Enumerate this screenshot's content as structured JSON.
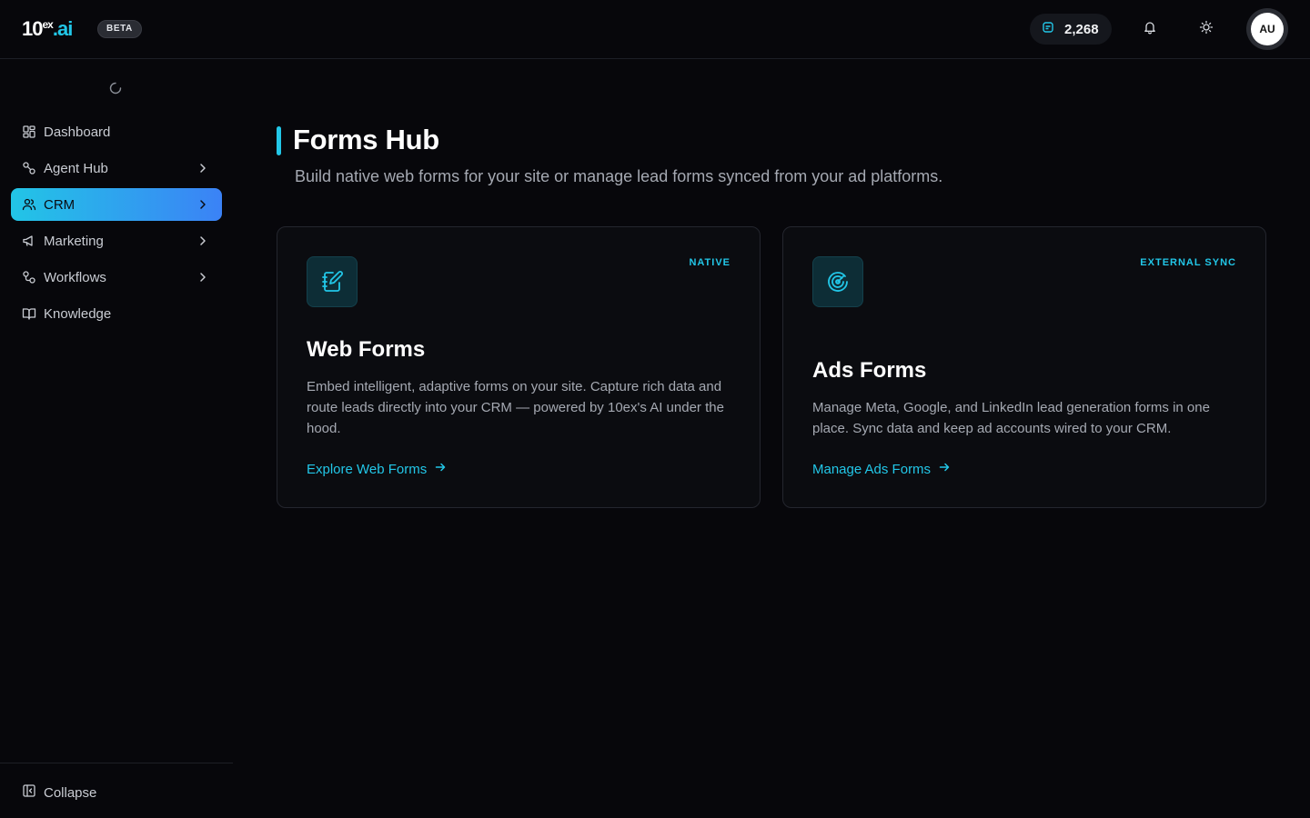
{
  "brand": {
    "ten": "10",
    "ex": "ex",
    "ai": ".ai",
    "badge": "BETA"
  },
  "topbar": {
    "credits": "2,268",
    "avatar_initials": "AU",
    "icons": [
      "coin-icon",
      "bell-icon",
      "sun-icon"
    ]
  },
  "sidebar": {
    "items": [
      {
        "label": "Dashboard",
        "icon": "dashboard-icon",
        "has_submenu": false
      },
      {
        "label": "Agent Hub",
        "icon": "agent-hub-icon",
        "has_submenu": true
      },
      {
        "label": "CRM",
        "icon": "users-icon",
        "has_submenu": true,
        "active": true
      },
      {
        "label": "Marketing",
        "icon": "megaphone-icon",
        "has_submenu": true
      },
      {
        "label": "Workflows",
        "icon": "workflow-icon",
        "has_submenu": true
      },
      {
        "label": "Knowledge",
        "icon": "book-icon",
        "has_submenu": false
      }
    ],
    "collapse_label": "Collapse"
  },
  "main": {
    "title": "Forms Hub",
    "subtitle": "Build native web forms for your site or manage lead forms synced from your ad platforms.",
    "cards": [
      {
        "tag": "NATIVE",
        "title": "Web Forms",
        "description": "Embed intelligent, adaptive forms on your site. Capture rich data and route leads directly into your CRM — powered by 10ex's AI under the hood.",
        "link": "Explore Web Forms",
        "icon": "notebook-pen-icon"
      },
      {
        "tag": "EXTERNAL SYNC",
        "title": "Ads Forms",
        "description": "Manage Meta, Google, and LinkedIn lead generation forms in one place. Sync data and keep ad accounts wired to your CRM.",
        "link": "Manage Ads Forms",
        "icon": "radar-icon"
      }
    ]
  },
  "colors": {
    "accent": "#22c7e8",
    "active_gradient_start": "#22c5e6",
    "active_gradient_end": "#3b82f6",
    "background": "#07070b"
  }
}
